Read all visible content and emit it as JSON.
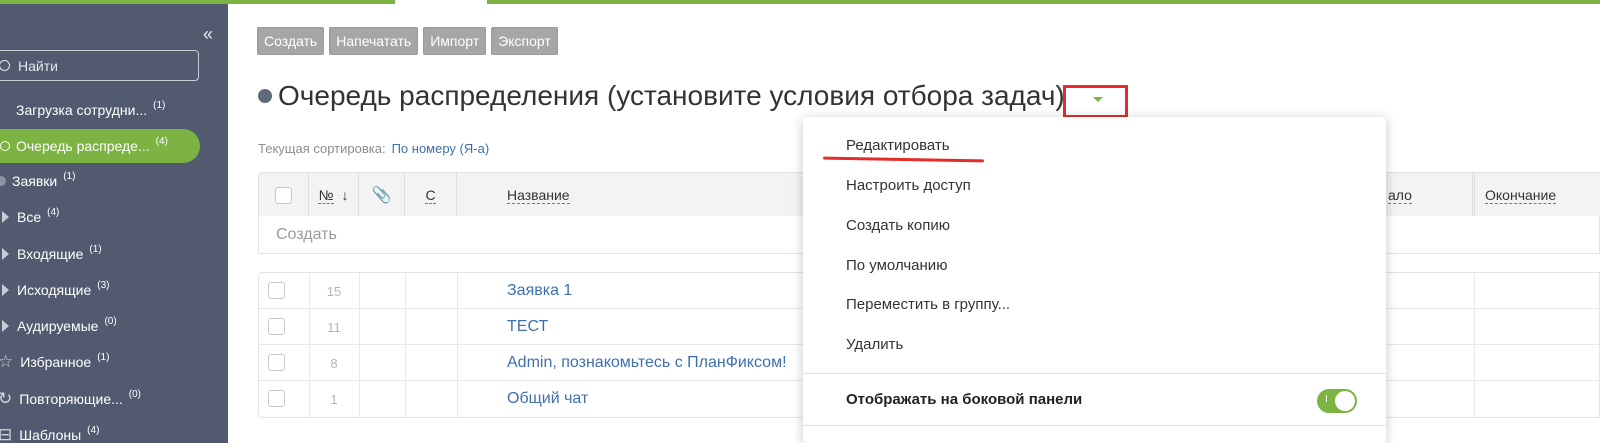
{
  "sidebar": {
    "collapse_icon": "«",
    "search_label": "Найти",
    "items": [
      {
        "label": "Загрузка сотрудни...",
        "count": "(1)"
      },
      {
        "label": "Очередь распреде...",
        "count": "(4)"
      },
      {
        "label": "Заявки",
        "count": "(1)"
      },
      {
        "label": "Все",
        "count": "(4)"
      },
      {
        "label": "Входящие",
        "count": "(1)"
      },
      {
        "label": "Исходящие",
        "count": "(3)"
      },
      {
        "label": "Аудируемые",
        "count": "(0)"
      },
      {
        "label": "Избранное",
        "count": "(1)"
      },
      {
        "label": "Повторяющие...",
        "count": "(0)"
      },
      {
        "label": "Шаблоны",
        "count": "(4)"
      }
    ]
  },
  "toolbar": {
    "create": "Создать",
    "print": "Напечатать",
    "import": "Импорт",
    "export": "Экспорт"
  },
  "page": {
    "title": "Очередь распределения (установите условия отбора задач)"
  },
  "sort": {
    "label": "Текущая сортировка:",
    "value": "По номеру (Я-а)"
  },
  "table": {
    "headers": {
      "number": "№",
      "sort_arrow": "↓",
      "attach_icon": "⊘",
      "c": "С",
      "name": "Название",
      "start": "ало",
      "end": "Окончание"
    },
    "create_placeholder": "Создать",
    "rows": [
      {
        "num": "15",
        "name": "Заявка 1"
      },
      {
        "num": "11",
        "name": "ТЕСТ"
      },
      {
        "num": "8",
        "name": "Admin, познакомьтесь с ПланФиксом!"
      },
      {
        "num": "1",
        "name": "Общий чат"
      }
    ]
  },
  "menu": {
    "items": [
      "Редактировать",
      "Настроить доступ",
      "Создать копию",
      "По умолчанию",
      "Переместить в группу...",
      "Удалить"
    ],
    "show_sidebar": "Отображать на боковой панели",
    "toggle_mark": "I"
  },
  "colors": {
    "accent": "#7cb342",
    "sidebar_bg": "#515a6e",
    "highlight_red": "#e52b2b",
    "link": "#3f6fad"
  }
}
